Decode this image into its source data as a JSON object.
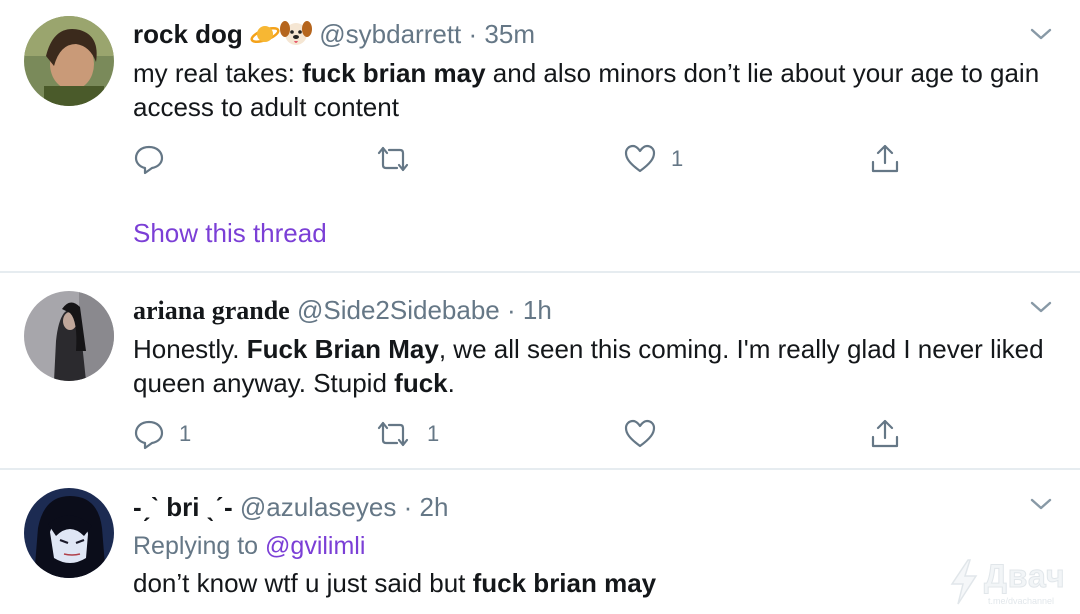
{
  "tweets": [
    {
      "name": "rock dog",
      "handle": "@sybdarrett",
      "sep": "·",
      "time": "35m",
      "text_parts": [
        "my real takes: ",
        "fuck brian may",
        " and also minors don’t lie about your age to gain access to adult content"
      ],
      "replies": "",
      "retweets": "",
      "likes": "1",
      "thread_link": "Show this thread"
    },
    {
      "name": "ariana grande",
      "handle": "@Side2Sidebabe",
      "sep": "·",
      "time": "1h",
      "text_parts": [
        "Honestly. ",
        "Fuck Brian May",
        ", we all seen this coming. I'm really glad I never liked queen anyway. Stupid ",
        "fuck",
        "."
      ],
      "replies": "1",
      "retweets": "1",
      "likes": ""
    },
    {
      "name": "-ˏˋ bri ˎˊ-",
      "handle": "@azulaseyes",
      "sep": "·",
      "time": "2h",
      "replying_prefix": "Replying to ",
      "replying_to": "@gvilimli",
      "text_parts": [
        "don’t know wtf u just said but ",
        "fuck brian may"
      ]
    }
  ],
  "watermark": {
    "text": "Двач",
    "sub": "t.me/dvachannel"
  },
  "colors": {
    "link": "#7b3fd6",
    "muted": "#657786",
    "divider": "#e6ecf0"
  }
}
